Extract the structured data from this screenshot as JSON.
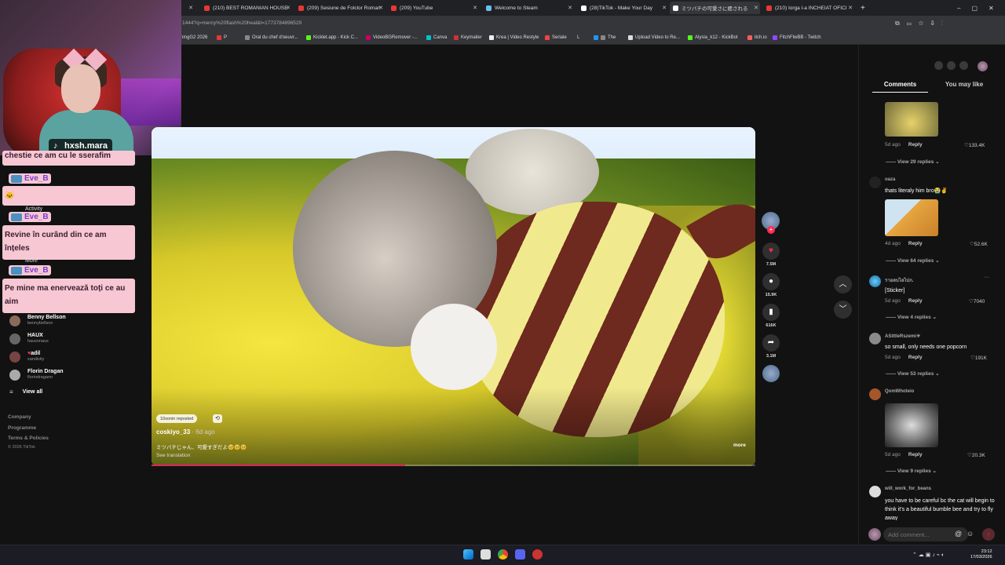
{
  "browser": {
    "tabs": [
      {
        "label": "(210) BEST ROMANIAN HOUSE"
      },
      {
        "label": "(209) Sesiune de Folclor Roman"
      },
      {
        "label": "(209) YouTube"
      },
      {
        "label": "Welcome to Steam"
      },
      {
        "label": "(28)TikTok - Make Your Day"
      },
      {
        "label": "ミツバチの可愛さに癒される"
      },
      {
        "label": "(210) Iorga l-a INCHEIAT OFICI"
      }
    ],
    "new_tab": "+",
    "url": "1444?q=mercy%20flash%20heal&t=1773784896529",
    "bookmarks": [
      "ningG2 2026",
      "P",
      "Oral du chef d'oeuvr...",
      "Kicklet.app - Kick C...",
      "VideoBGRemover -...",
      "Canva",
      "Keymailer",
      "Krea | Video Restyle",
      "Seriale",
      "L",
      "The",
      "Upload Video to Re...",
      "Alysia_k12 - KickBot",
      "itch.io",
      "FitchFlwBB - Twitch"
    ]
  },
  "stream": {
    "cam_tag": "hxsh.mara",
    "chat": [
      {
        "name": "",
        "text": "chestie ce am cu le sserafim"
      },
      {
        "name": "Eve_B",
        "text": "🐱"
      },
      {
        "name": "Eve_B",
        "text": "Revine în curând din ce am înțeles"
      },
      {
        "name": "Eve_B",
        "text": "Pe mine ma enervează toți ce au aim"
      }
    ],
    "ghost_labels": [
      "Activity",
      "More"
    ]
  },
  "sidebar": {
    "following": [
      {
        "name": "Benny Bellson",
        "handle": "bennybellson"
      },
      {
        "name": "HAUX",
        "handle": "hauxonaux"
      },
      {
        "name": "adil",
        "handle": "xandivity"
      },
      {
        "name": "Florin Dragan",
        "handle": "florindragann"
      }
    ],
    "view_all": "View all",
    "footer": [
      "Company",
      "Programme",
      "Terms & Policies",
      "© 2026 TikTok"
    ]
  },
  "video": {
    "repost_label": "10sonin reposted",
    "author": "coskiyo_33",
    "posted": "· 6d ago",
    "caption": "ミツバチじゃん、可愛すぎだよ🥺🥺🥺",
    "see_translation": "See translation",
    "more": "more",
    "progress": 0.42
  },
  "actions": {
    "likes": "7.5M",
    "comments": "15.9K",
    "saves": "616K",
    "shares": "3.1M"
  },
  "panel": {
    "tab_comments": "Comments",
    "tab_you_may_like": "You may like",
    "comments": [
      {
        "user": "",
        "text": "",
        "meta": "5d ago",
        "reply": "Reply",
        "likes": "133.4K",
        "view": "View 29 replies"
      },
      {
        "user": "oaza",
        "text": "thats literaly him bro😭✌️",
        "meta": "4d ago",
        "reply": "Reply",
        "likes": "52.6K",
        "view": "View 64 replies"
      },
      {
        "user": "ราอลบไลไปก.",
        "text": "[Sticker]",
        "meta": "5d ago",
        "reply": "Reply",
        "likes": "7040",
        "view": "View 4 replies"
      },
      {
        "user": "ASittleRszemi☀",
        "text": "so small, only needs one popcorn",
        "meta": "5d ago",
        "reply": "Reply",
        "likes": "191K",
        "view": "View 53 replies"
      },
      {
        "user": "QomWhoteio",
        "text": "",
        "meta": "5d ago",
        "reply": "Reply",
        "likes": "20.3K",
        "view": "View 9 replies"
      },
      {
        "user": "will_work_for_beans",
        "text": "you have to be careful bc the cat will begin to think it's a beautiful bumble bee and try to fly away",
        "meta": "",
        "reply": "",
        "likes": "",
        "view": ""
      }
    ],
    "add_comment_placeholder": "Add comment..."
  },
  "taskbar": {
    "time": "23:12",
    "date": "17/03/2026"
  },
  "colors": {
    "accent": "#fe2c55",
    "chat_bg": "#f7c7d3",
    "chat_name": "#7a3ed0"
  }
}
